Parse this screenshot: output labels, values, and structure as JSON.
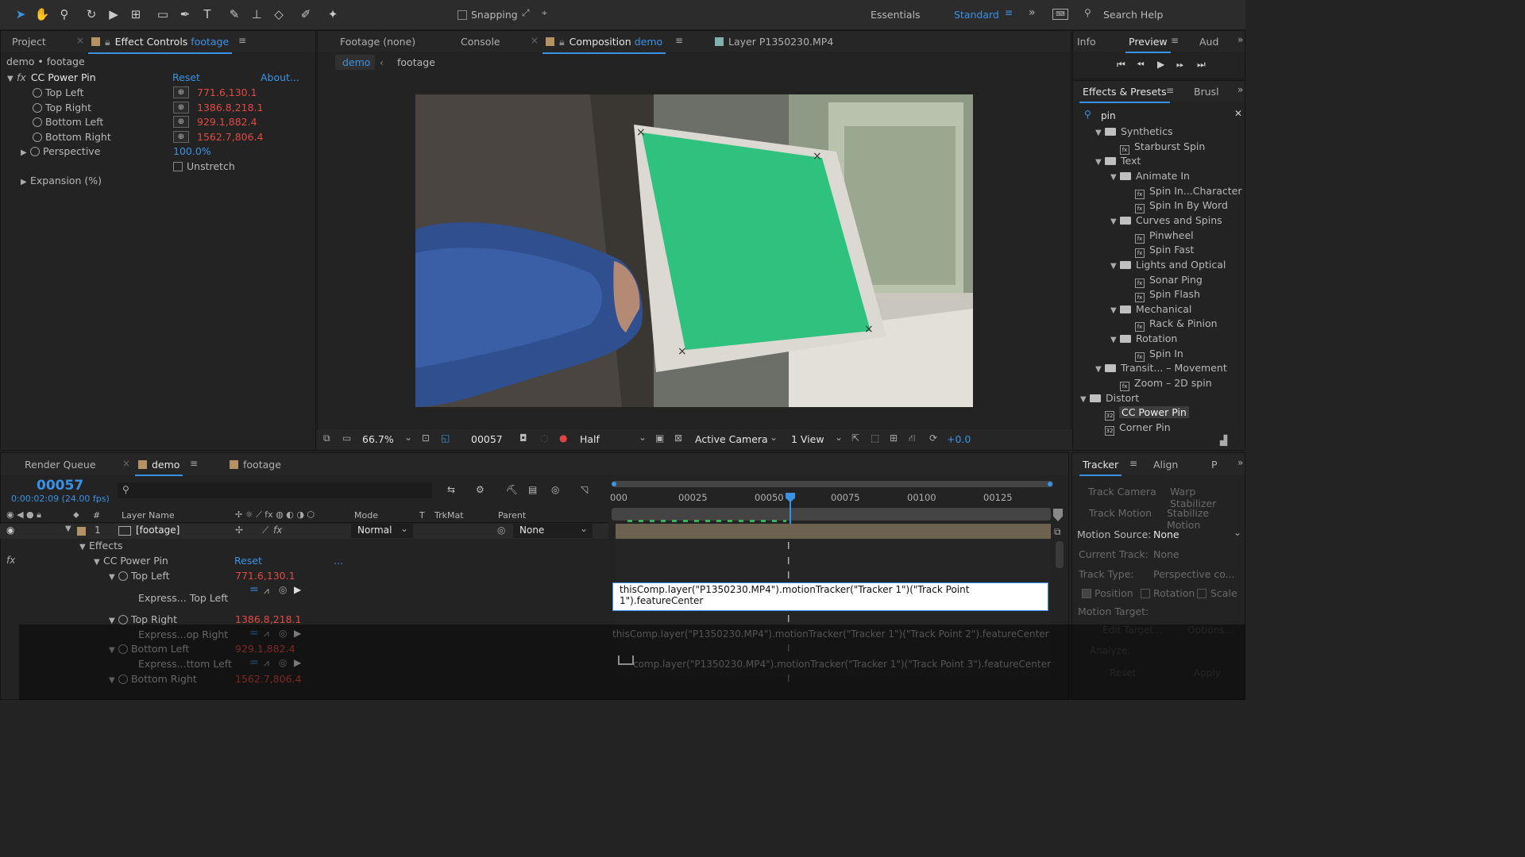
{
  "toolbar": {
    "snapping_label": "Snapping",
    "workspace_essentials": "Essentials",
    "workspace_standard": "Standard",
    "search_help": "Search Help"
  },
  "left_panel": {
    "tab_project": "Project",
    "tab_effect_controls": "Effect Controls",
    "tab_effect_controls_layer": "footage",
    "breadcrumb": "demo • footage",
    "effect_name": "CC Power Pin",
    "reset": "Reset",
    "about": "About...",
    "params": [
      {
        "label": "Top Left",
        "value": "771.6,130.1"
      },
      {
        "label": "Top Right",
        "value": "1386.8,218.1"
      },
      {
        "label": "Bottom Left",
        "value": "929.1,882.4"
      },
      {
        "label": "Bottom Right",
        "value": "1562.7,806.4"
      }
    ],
    "perspective_label": "Perspective",
    "perspective_value": "100.0%",
    "unstretch_label": "Unstretch",
    "expansion_label": "Expansion (%)"
  },
  "center_panel": {
    "tab_footage": "Footage (none)",
    "tab_console": "Console",
    "tab_composition": "Composition",
    "tab_composition_name": "demo",
    "tab_layer": "Layer P1350230.MP4",
    "crumb_demo": "demo",
    "crumb_footage": "footage",
    "zoom": "66.7%",
    "frame": "00057",
    "resolution": "Half",
    "camera": "Active Camera",
    "views": "1 View",
    "exposure": "+0.0"
  },
  "right_top": {
    "tab_info": "Info",
    "tab_preview": "Preview",
    "tab_audio": "Aud"
  },
  "effects_presets": {
    "tab": "Effects & Presets",
    "tab_brush": "Brusl",
    "search_value": "pin",
    "tree": [
      {
        "label": "Synthetics",
        "kind": "folder",
        "level": 1
      },
      {
        "label": "Starburst Spin",
        "kind": "preset",
        "level": 2
      },
      {
        "label": "Text",
        "kind": "folder",
        "level": 1
      },
      {
        "label": "Animate In",
        "kind": "folder",
        "level": 2
      },
      {
        "label": "Spin In...Character",
        "kind": "preset",
        "level": 3
      },
      {
        "label": "Spin In By Word",
        "kind": "preset",
        "level": 3
      },
      {
        "label": "Curves and Spins",
        "kind": "folder",
        "level": 2
      },
      {
        "label": "Pinwheel",
        "kind": "preset",
        "level": 3
      },
      {
        "label": "Spin Fast",
        "kind": "preset",
        "level": 3
      },
      {
        "label": "Lights and Optical",
        "kind": "folder",
        "level": 2
      },
      {
        "label": "Sonar Ping",
        "kind": "preset",
        "level": 3
      },
      {
        "label": "Spin Flash",
        "kind": "preset",
        "level": 3
      },
      {
        "label": "Mechanical",
        "kind": "folder",
        "level": 2
      },
      {
        "label": "Rack & Pinion",
        "kind": "preset",
        "level": 3
      },
      {
        "label": "Rotation",
        "kind": "folder",
        "level": 2
      },
      {
        "label": "Spin In",
        "kind": "preset",
        "level": 3
      },
      {
        "label": "Transit... – Movement",
        "kind": "folder",
        "level": 1
      },
      {
        "label": "Zoom – 2D spin",
        "kind": "preset",
        "level": 2
      },
      {
        "label": "Distort",
        "kind": "folder",
        "level": 0
      },
      {
        "label": "CC Power Pin",
        "kind": "effect",
        "level": 1,
        "selected": true
      },
      {
        "label": "Corner Pin",
        "kind": "effect",
        "level": 1
      }
    ]
  },
  "timeline": {
    "tab_render_queue": "Render Queue",
    "tab_demo": "demo",
    "tab_footage": "footage",
    "current_frame": "00057",
    "timecode": "0:00:02:09 (24.00 fps)",
    "col_layer_name": "Layer Name",
    "col_mode": "Mode",
    "col_t": "T",
    "col_trkmat": "TrkMat",
    "col_parent": "Parent",
    "layer_number": "1",
    "layer_name": "[footage]",
    "layer_mode": "Normal",
    "layer_parent": "None",
    "effects_label": "Effects",
    "effect_name": "CC Power Pin",
    "effect_reset": "Reset",
    "effect_more": "...",
    "props": [
      {
        "label": "Top Left",
        "value": "771.6,130.1",
        "expr_label": "Express... Top Left"
      },
      {
        "label": "Top Right",
        "value": "1386.8,218.1",
        "expr_label": "Express...op Right"
      },
      {
        "label": "Bottom Left",
        "value": "929.1,882.4",
        "expr_label": "Express...ttom Left"
      },
      {
        "label": "Bottom Right",
        "value": "1562.7,806.4"
      }
    ],
    "ruler_labels": [
      "000",
      "00025",
      "00050",
      "00075",
      "00100",
      "00125"
    ],
    "expr_editing": "thisComp.layer(\"P1350230.MP4\").motionTracker(\"Tracker 1\")(\"Track Point 1\").featureCenter",
    "expr_2": "thisComp.layer(\"P1350230.MP4\").motionTracker(\"Tracker 1\")(\"Track Point 2\").featureCenter",
    "expr_3": "comp.layer(\"P1350230.MP4\").motionTracker(\"Tracker 1\")(\"Track Point 3\").featureCenter"
  },
  "tracker": {
    "tab": "Tracker",
    "tab_align": "Align",
    "tab_p": "P",
    "track_camera": "Track Camera",
    "warp_stabilizer": "Warp Stabilizer",
    "track_motion": "Track Motion",
    "stabilize_motion": "Stabilize Motion",
    "motion_source_label": "Motion Source:",
    "motion_source_value": "None",
    "current_track_label": "Current Track:",
    "current_track_value": "None",
    "track_type_label": "Track Type:",
    "track_type_value": "Perspective co...",
    "position": "Position",
    "rotation": "Rotation",
    "scale": "Scale",
    "motion_target_label": "Motion Target:",
    "edit_target": "Edit Target...",
    "options": "Options...",
    "analyze": "Analyze:",
    "reset": "Reset",
    "apply": "Apply"
  },
  "colors": {
    "accent_blue": "#3a92e6",
    "value_red": "#e14a43",
    "green_screen": "#2fc27e"
  }
}
